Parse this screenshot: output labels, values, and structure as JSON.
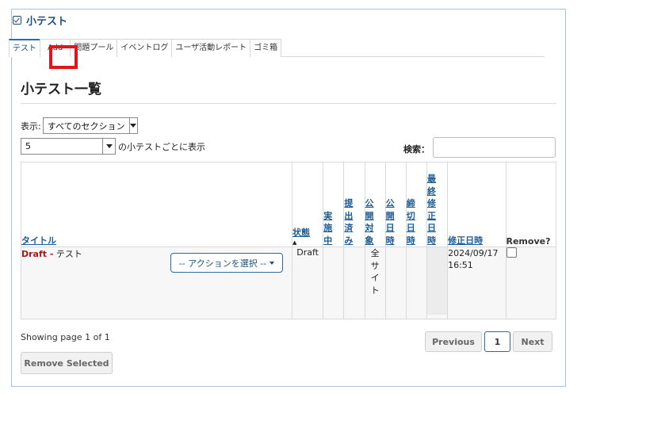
{
  "tool": {
    "title": "小テスト",
    "icon": "checkbox-icon"
  },
  "tabs": [
    {
      "label": "テスト"
    },
    {
      "label": "Add"
    },
    {
      "label": "問題プール"
    },
    {
      "label": "イベントログ"
    },
    {
      "label": "ユーザ活動レポート"
    },
    {
      "label": "ゴミ箱"
    }
  ],
  "highlight_color": "#e0161b",
  "page_heading": "小テスト一覧",
  "filter": {
    "show_label": "表示:",
    "section_value": "すべてのセクション"
  },
  "per_page": {
    "value": "5",
    "suffix": "の小テストごとに表示"
  },
  "search": {
    "label": "検索：",
    "value": ""
  },
  "table": {
    "headers": {
      "title": "タイトル",
      "status": "状態",
      "status_sort": "▲",
      "in_progress": [
        "実",
        "施",
        "中"
      ],
      "submitted": [
        "提",
        "出",
        "済",
        "み"
      ],
      "release_to": [
        "公",
        "開",
        "対",
        "象"
      ],
      "open_date": [
        "公",
        "開",
        "日",
        "時"
      ],
      "due_date": [
        "締",
        "切",
        "日",
        "時"
      ],
      "last_modified_by": [
        "最",
        "終",
        "修",
        "正",
        "日",
        "時"
      ],
      "modified_date": "修正日時",
      "remove": "Remove?"
    },
    "rows": [
      {
        "draft_label": "Draft -",
        "title": "テスト",
        "action_label": "-- アクションを選択 --",
        "status": "Draft",
        "release_to": [
          "全",
          "サ",
          "イ",
          "ト"
        ],
        "modified_date": "2024/09/17",
        "modified_time": "16:51"
      }
    ]
  },
  "pagination": {
    "showing": "Showing page 1 of 1",
    "previous": "Previous",
    "current": "1",
    "next": "Next"
  },
  "remove_selected": "Remove Selected",
  "colors": {
    "accent": "#1d4e7d",
    "link": "#1d5b94",
    "draft": "#a3171d"
  }
}
